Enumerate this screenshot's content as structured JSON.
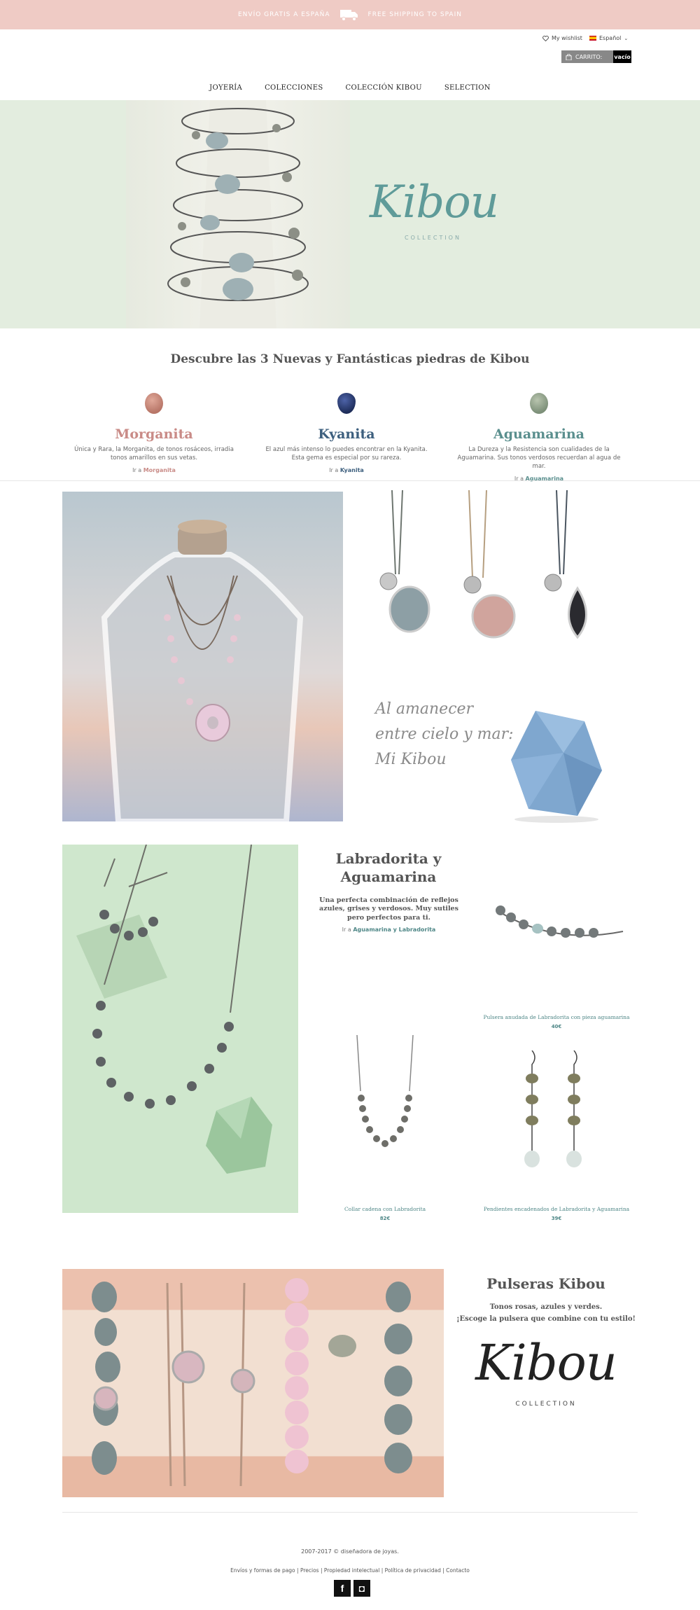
{
  "topbar": {
    "free_shipping_es": "ENVÍO GRATIS A ESPAÑA",
    "free_shipping_en": "FREE SHIPPING TO SPAIN",
    "truck_icon": "truck-icon"
  },
  "header": {
    "wishlist": "My wishlist",
    "language": "Español",
    "cart_label": "CARRITO:",
    "cart_status": "vacío"
  },
  "nav": {
    "items": [
      "JOYERÍA",
      "COLECCIONES",
      "COLECCIÓN KIBOU",
      "SELECTION"
    ]
  },
  "hero": {
    "logo": "Kibou",
    "logo_sub": "COLLECTION",
    "bg_color": "#e3eddf"
  },
  "stones": {
    "title": "Descubre las 3 Nuevas y Fantásticas piedras de Kibou",
    "items": [
      {
        "name": "Morganita",
        "color": "#c98b87",
        "stone_color": "#b87668",
        "desc": "Única y Rara, la Morganita, de tonos rosáceos, irradia tonos amarillos en sus vetas.",
        "link_prefix": "Ir a",
        "link_name": "Morganita"
      },
      {
        "name": "Kyanita",
        "color": "#3d5f7e",
        "stone_color": "#1e2d5a",
        "desc": "El azul más intenso lo puedes encontrar en la Kyanita. Esta gema es especial por su rareza.",
        "link_prefix": "Ir a",
        "link_name": "Kyanita"
      },
      {
        "name": "Aguamarina",
        "color": "#5a8f8e",
        "stone_color": "#8a9c85",
        "desc": "La Dureza y la Resistencia son cualidades de la Aguamarina. Sus tonos verdosos recuerdan al agua de mar.",
        "link_prefix": "Ir a",
        "link_name": "Aguamarina"
      }
    ]
  },
  "section_dawn": {
    "script_lines": [
      "Al amanecer",
      "entre cielo y mar:",
      "Mi Kibou"
    ]
  },
  "section_labradorita": {
    "title_line1": "Labradorita y",
    "title_line2": "Aguamarina",
    "desc": "Una perfecta combinación de reflejos azules, grises y verdosos. Muy sutiles pero perfectos para ti.",
    "link_prefix": "Ir a",
    "link_name": "Aguamarina y Labradorita",
    "products": [
      {
        "name": "Pulsera anudada de Labradorita con pieza aguamarina",
        "price": "40€"
      },
      {
        "name": "Collar cadena con Labradorita",
        "price": "82€"
      },
      {
        "name": "Pendientes encadenados de Labradorita y Aguamarina",
        "price": "39€"
      }
    ]
  },
  "section_pulseras": {
    "title": "Pulseras Kibou",
    "line1": "Tonos rosas, azules y verdes.",
    "line2": "¡Escoge la pulsera que combine con tu estilo!",
    "logo": "Kibou",
    "logo_sub": "COLLECTION"
  },
  "footer": {
    "copyright": "2007-2017 © diseñadora de joyas.",
    "links": [
      "Envíos y formas de pago",
      "Precios",
      "Propiedad intelectual",
      "Política de privacidad",
      "Contacto"
    ],
    "social": [
      {
        "icon": "facebook-icon",
        "glyph": "f"
      },
      {
        "icon": "instagram-icon",
        "glyph": "◘"
      }
    ]
  }
}
